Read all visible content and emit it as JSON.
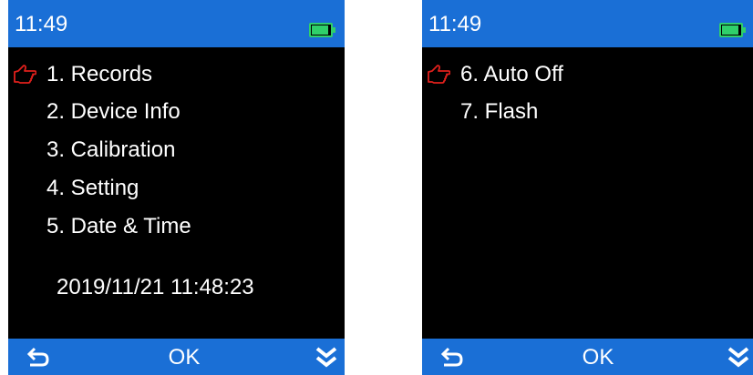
{
  "colors": {
    "bar": "#1a6fd6",
    "screen_bg": "#000000",
    "text": "#ffffff",
    "battery": "#2fd06a",
    "pointer": "#e0201c"
  },
  "screens": [
    {
      "time": "11:49",
      "battery_icon": "battery-full-icon",
      "selected_index": 0,
      "items": [
        {
          "label": "1. Records"
        },
        {
          "label": "2. Device Info"
        },
        {
          "label": "3. Calibration"
        },
        {
          "label": "4. Setting"
        },
        {
          "label": "5. Date & Time"
        }
      ],
      "datetime": "2019/11/21 11:48:23",
      "bottom": {
        "back_icon": "back-arrow-icon",
        "ok_label": "OK",
        "next_icon": "double-chevron-down-icon"
      }
    },
    {
      "time": "11:49",
      "battery_icon": "battery-full-icon",
      "selected_index": 0,
      "items": [
        {
          "label": "6. Auto Off"
        },
        {
          "label": "7. Flash"
        }
      ],
      "bottom": {
        "back_icon": "back-arrow-icon",
        "ok_label": "OK",
        "next_icon": "double-chevron-down-icon"
      }
    }
  ]
}
